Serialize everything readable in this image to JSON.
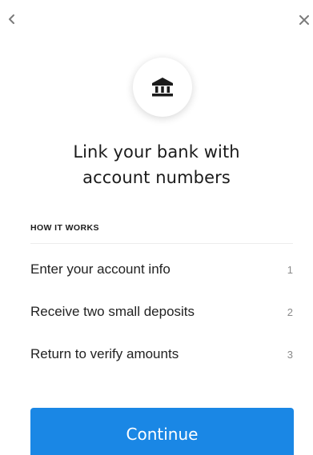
{
  "nav": {
    "back_icon": "chevron-left-icon",
    "close_icon": "close-icon"
  },
  "header": {
    "icon": "bank-icon",
    "title_line1": "Link your bank with",
    "title_line2": "account numbers"
  },
  "how_it_works": {
    "label": "HOW IT WORKS",
    "steps": [
      {
        "text": "Enter your account info",
        "number": "1"
      },
      {
        "text": "Receive two small deposits",
        "number": "2"
      },
      {
        "text": "Return to verify amounts",
        "number": "3"
      }
    ]
  },
  "actions": {
    "continue_label": "Continue"
  },
  "colors": {
    "primary": "#1a87e5",
    "text": "#1b1b1b",
    "muted": "#8a8a8a",
    "divider": "#ececec"
  }
}
